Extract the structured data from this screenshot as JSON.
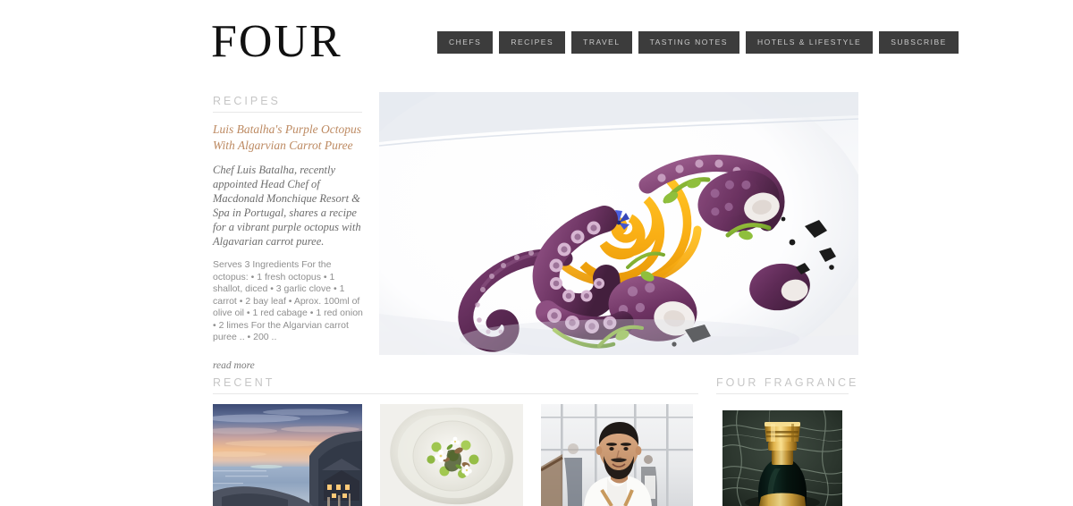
{
  "site": {
    "logo": "FOUR",
    "background_color": "#ffffff"
  },
  "nav": {
    "items": [
      {
        "label": "CHEFS",
        "name": "nav-item-chefs"
      },
      {
        "label": "RECIPES",
        "name": "nav-item-recipes"
      },
      {
        "label": "TRAVEL",
        "name": "nav-item-travel"
      },
      {
        "label": "TASTING NOTES",
        "name": "nav-item-tasting-notes"
      },
      {
        "label": "HOTELS & LIFESTYLE",
        "name": "nav-item-hotels-lifestyle"
      },
      {
        "label": "SUBSCRIBE",
        "name": "nav-item-subscribe"
      }
    ],
    "button_color": "#3c3c3c",
    "button_text_color": "#c9c9c9"
  },
  "sections": {
    "recipes_heading": "RECIPES",
    "recent_heading": "RECENT",
    "fragrance_heading": "FOUR FRAGRANCE",
    "heading_color": "#c6c6c6"
  },
  "feature": {
    "title": "Luis Batalha's Purple Octopus With Algarvian Carrot Puree",
    "title_color": "#bd8a62",
    "standfirst": "Chef Luis Batalha, recently appointed Head Chef of Macdonald Monchique Resort & Spa in Portugal, shares a recipe for a vibrant purple octopus with Algavarian carrot puree.",
    "excerpt": "Serves 3 Ingredients For the octopus: • 1 fresh octopus • 1 shallot, diced • 3 garlic clove • 1 carrot • 2 bay leaf • Aprox. 100ml of olive oil • 1 red cabage • 1 red onion • 2 limes For the Algarvian carrot puree .. • 200 ..",
    "read_more": "read more",
    "hero_image_alt": "purple octopus dish with orange carrot puree spiral on white plate"
  },
  "thumbnails": [
    {
      "name": "thumbnail-coastal-sunset",
      "alt": "coastal sunset seascape with cliffside hotel"
    },
    {
      "name": "thumbnail-plated-dish",
      "alt": "white ceramic bowl with green pea dish and flowers"
    },
    {
      "name": "thumbnail-chef-portrait",
      "alt": "smiling bearded chef in white jacket"
    },
    {
      "name": "thumbnail-fragrance-bottle",
      "alt": "dark perfume bottle with gold cap on green marble"
    }
  ]
}
